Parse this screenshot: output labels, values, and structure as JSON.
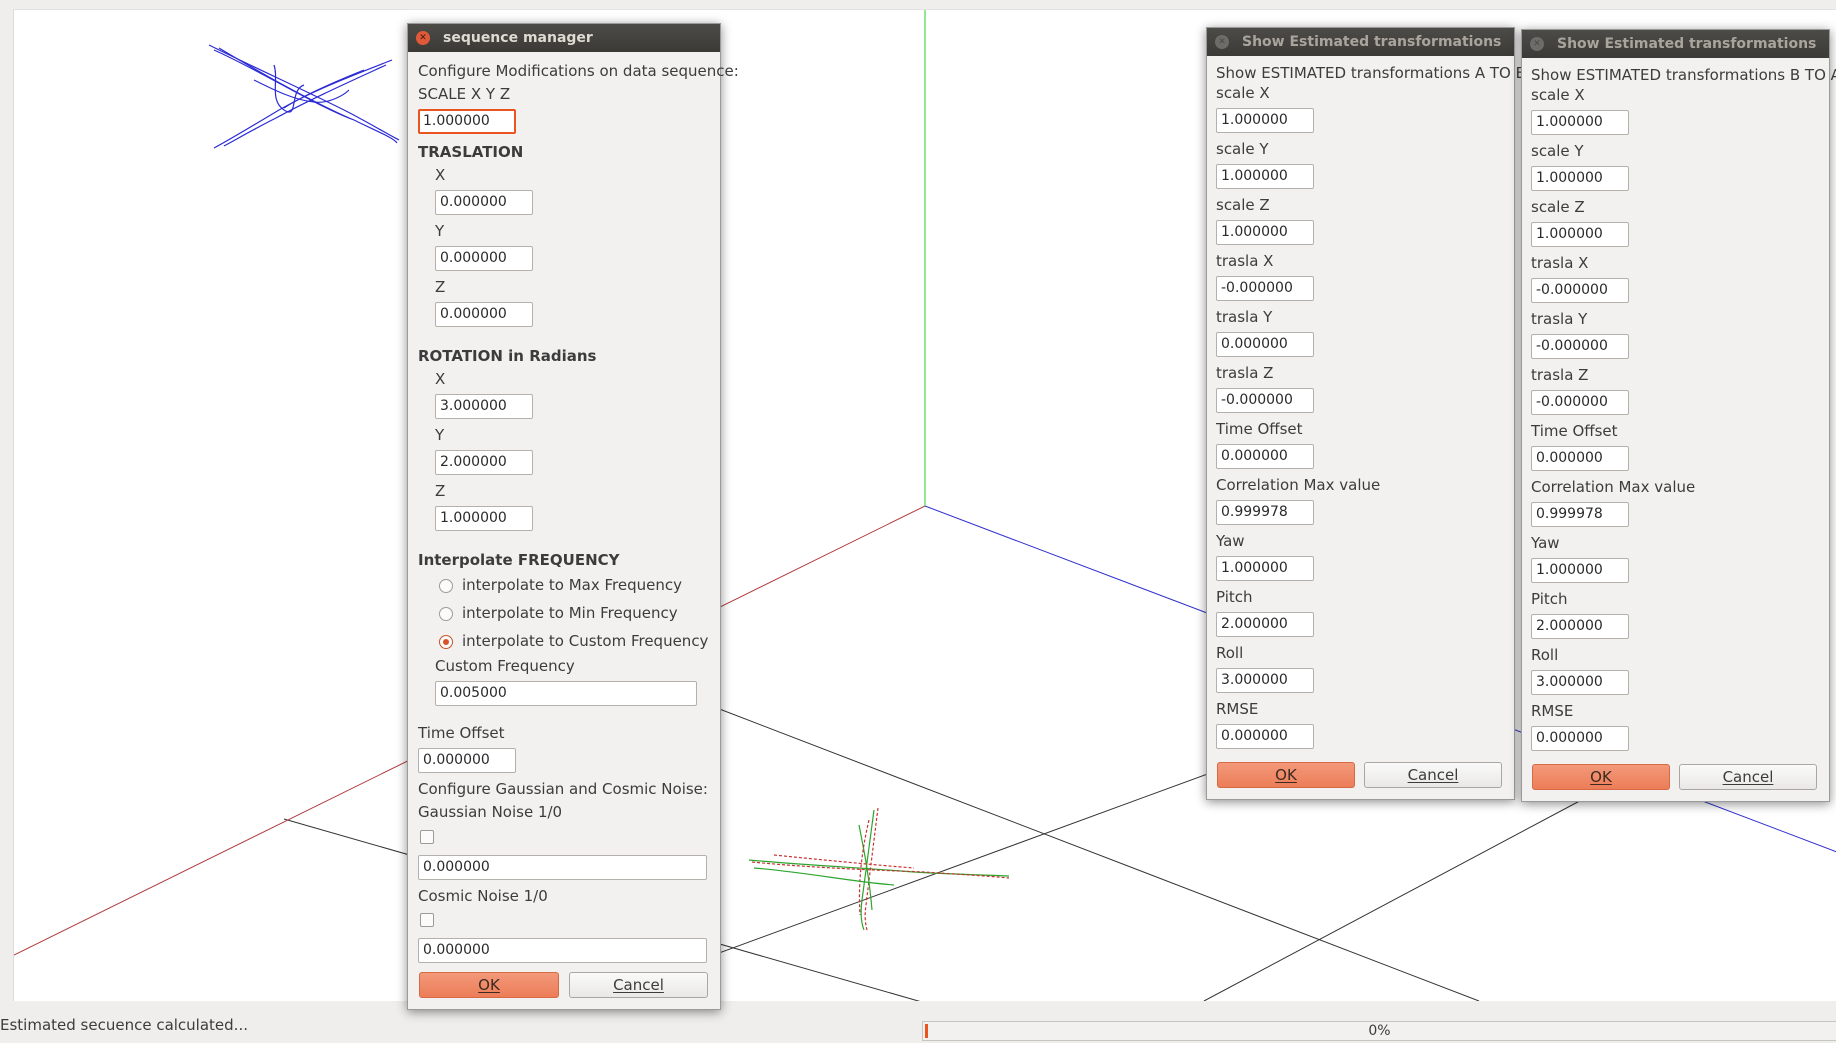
{
  "status": {
    "message": "Estimated secuence calculated...",
    "progress_text": "0%",
    "progress": 0
  },
  "sequence_manager": {
    "title": "sequence manager",
    "configure_label": "Configure Modifications on data sequence:",
    "scale_label": "SCALE X Y Z",
    "scale_value": "1.000000",
    "traslation_header": "TRASLATION",
    "traslation": {
      "x_label": "X",
      "x": "0.000000",
      "y_label": "Y",
      "y": "0.000000",
      "z_label": "Z",
      "z": "0.000000"
    },
    "rotation_header": "ROTATION in Radians",
    "rotation": {
      "x_label": "X",
      "x": "3.000000",
      "y_label": "Y",
      "y": "2.000000",
      "z_label": "Z",
      "z": "1.000000"
    },
    "interpolate_header": "Interpolate FREQUENCY",
    "radio_max": "interpolate to Max Frequency",
    "radio_min": "interpolate to Min Frequency",
    "radio_custom": "interpolate to Custom Frequency",
    "custom_freq_label": "Custom Frequency",
    "custom_freq": "0.005000",
    "time_offset_label": "Time Offset",
    "time_offset": "0.000000",
    "noise_label": "Configure Gaussian and Cosmic Noise:",
    "gaussian_label": "Gaussian Noise 1/0",
    "gaussian_value": "0.000000",
    "cosmic_label": "Cosmic Noise 1/0",
    "cosmic_value": "0.000000",
    "ok": "OK",
    "cancel": "Cancel"
  },
  "est_a_to_b": {
    "title": "Show Estimated transformations",
    "heading": "Show ESTIMATED transformations A TO B:",
    "fields": [
      {
        "label": "scale X",
        "value": "1.000000"
      },
      {
        "label": "scale Y",
        "value": "1.000000"
      },
      {
        "label": "scale Z",
        "value": "1.000000"
      },
      {
        "label": "trasla X",
        "value": "-0.000000"
      },
      {
        "label": "trasla Y",
        "value": "0.000000"
      },
      {
        "label": "trasla Z",
        "value": "-0.000000"
      },
      {
        "label": "Time Offset",
        "value": "0.000000"
      },
      {
        "label": "Correlation Max value",
        "value": "0.999978"
      },
      {
        "label": "Yaw",
        "value": "1.000000"
      },
      {
        "label": "Pitch",
        "value": "2.000000"
      },
      {
        "label": "Roll",
        "value": "3.000000"
      },
      {
        "label": "RMSE",
        "value": "0.000000"
      }
    ],
    "ok": "OK",
    "cancel": "Cancel"
  },
  "est_b_to_a": {
    "title": "Show Estimated transformations",
    "heading": "Show ESTIMATED transformations B TO A:",
    "fields": [
      {
        "label": "scale X",
        "value": "1.000000"
      },
      {
        "label": "scale Y",
        "value": "1.000000"
      },
      {
        "label": "scale Z",
        "value": "1.000000"
      },
      {
        "label": "trasla X",
        "value": "-0.000000"
      },
      {
        "label": "trasla Y",
        "value": "-0.000000"
      },
      {
        "label": "trasla Z",
        "value": "-0.000000"
      },
      {
        "label": "Time Offset",
        "value": "0.000000"
      },
      {
        "label": "Correlation Max value",
        "value": "0.999978"
      },
      {
        "label": "Yaw",
        "value": "1.000000"
      },
      {
        "label": "Pitch",
        "value": "2.000000"
      },
      {
        "label": "Roll",
        "value": "3.000000"
      },
      {
        "label": "RMSE",
        "value": "0.000000"
      }
    ],
    "ok": "OK",
    "cancel": "Cancel"
  },
  "colors": {
    "accent": "#e95420",
    "x_axis": "#a83232",
    "y_axis": "#22c922",
    "z_axis": "#2c2cc8",
    "grid": "#222222"
  }
}
